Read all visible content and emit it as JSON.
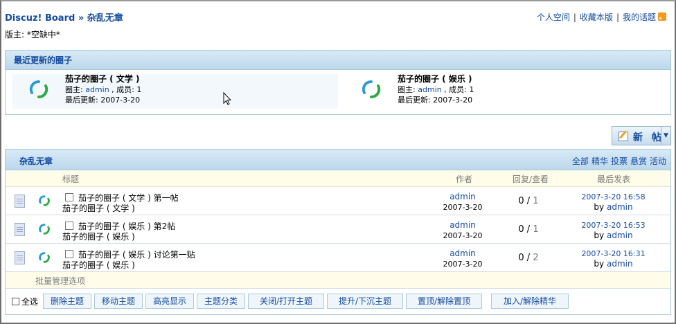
{
  "header": {
    "breadcrumb": "Discuz! Board » 杂乱无章",
    "links": [
      "个人空间",
      "收藏本版",
      "我的话题"
    ],
    "moderator": "版主: *空缺中*"
  },
  "recent_circles": {
    "title": "最近更新的圈子",
    "items": [
      {
        "name": "茄子的圈子 ( 文学 )",
        "owner_label": "圈主: ",
        "owner": "admin",
        "members": " , 成员: 1",
        "updated": "最后更新: 2007-3-20"
      },
      {
        "name": "茄子的圈子 ( 娱乐 )",
        "owner_label": "圈主: ",
        "owner": "admin",
        "members": " , 成员: 1",
        "updated": "最后更新: 2007-3-20"
      }
    ]
  },
  "new_post_button": "新 帖",
  "threads": {
    "title": "杂乱无章",
    "filters": [
      "全部",
      "精华",
      "投票",
      "悬赏",
      "活动"
    ],
    "columns": {
      "subject": "标题",
      "author": "作者",
      "replies": "回复/查看",
      "last": "最后发表"
    },
    "rows": [
      {
        "subject": "茄子的圈子 ( 文学 ) 第一帖",
        "circle": "茄子的圈子 ( 文学 )",
        "author": "admin",
        "date": "2007-3-20",
        "replies": "0",
        "views": "1",
        "last_time": "2007-3-20 16:58",
        "last_by": "admin"
      },
      {
        "subject": "茄子的圈子 ( 娱乐 ) 第2帖",
        "circle": "茄子的圈子 ( 娱乐 )",
        "author": "admin",
        "date": "2007-3-20",
        "replies": "0",
        "views": "1",
        "last_time": "2007-3-20 16:53",
        "last_by": "admin"
      },
      {
        "subject": "茄子的圈子 ( 娱乐 ) 讨论第一贴",
        "circle": "茄子的圈子 ( 娱乐 )",
        "author": "admin",
        "date": "2007-3-20",
        "replies": "0",
        "views": "2",
        "last_time": "2007-3-20 16:31",
        "last_by": "admin"
      }
    ],
    "batch_label": "批量管理选项",
    "select_all": "全选",
    "actions": [
      "删除主题",
      "移动主题",
      "高亮显示",
      "主题分类",
      "关闭/打开主题",
      "提升/下沉主题",
      "置顶/解除置顶",
      "加入/解除精华"
    ]
  },
  "colors": {
    "link": "#154ba0",
    "header_bg": "#bcd7ec",
    "col_bg": "#fffdea"
  }
}
